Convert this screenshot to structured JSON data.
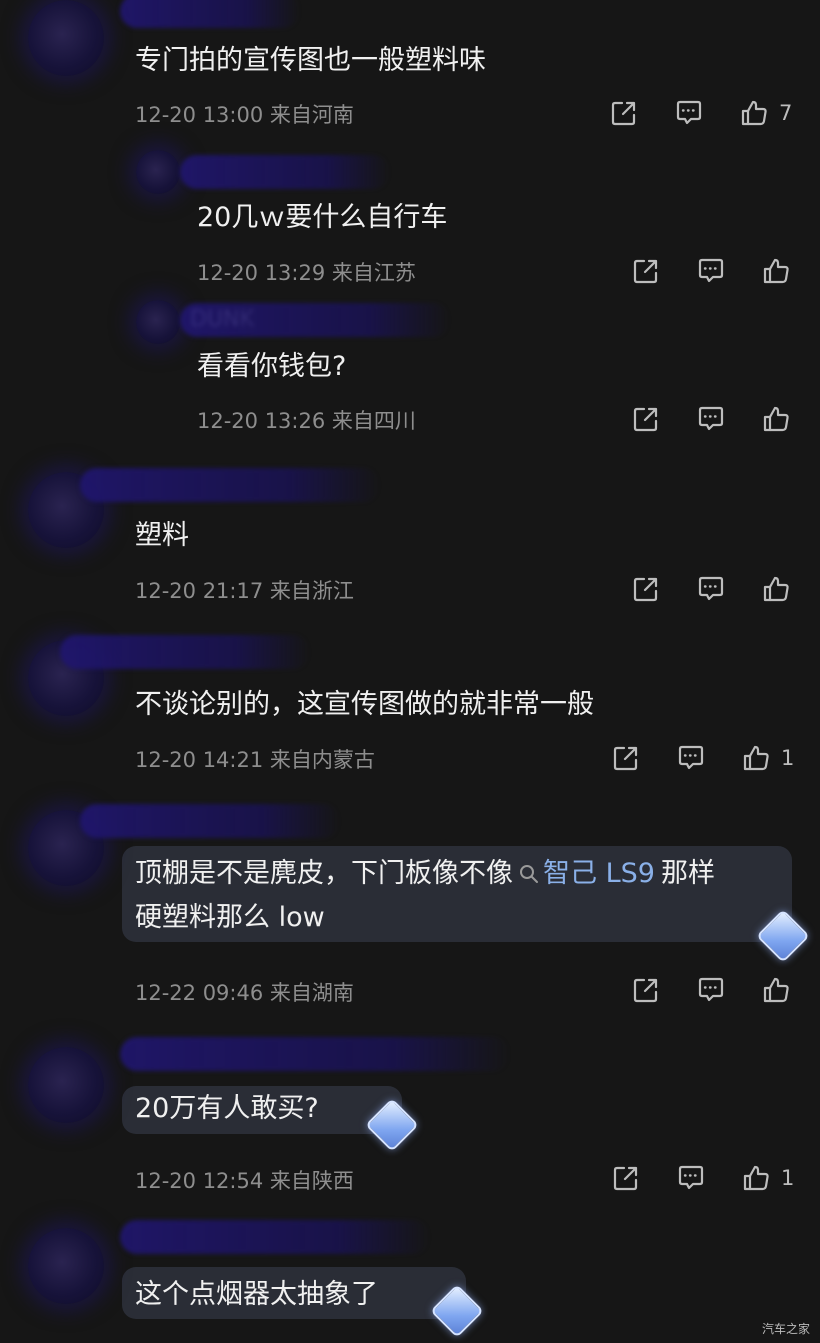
{
  "comments": [
    {
      "username": "",
      "text": "专门拍的宣传图也一般塑料味",
      "time": "12-20 13:00",
      "location": "来自河南",
      "likes": "7"
    },
    {
      "username": "",
      "text": "20几ｗ要什么自行车",
      "time": "12-20 13:29",
      "location": "来自江苏",
      "likes": ""
    },
    {
      "username": "DUNK",
      "text": "看看你钱包?",
      "time": "12-20 13:26",
      "location": "来自四川",
      "likes": ""
    },
    {
      "username": "",
      "text": "塑料",
      "time": "12-20 21:17",
      "location": "来自浙江",
      "likes": ""
    },
    {
      "username": "",
      "text": "不谈论别的，这宣传图做的就非常一般",
      "time": "12-20 14:21",
      "location": "来自内蒙古",
      "likes": "1"
    },
    {
      "username": "",
      "text_part1": "顶棚是不是麂皮，下门板像不像",
      "link": "智己 LS9",
      "text_part2": "那样",
      "text_line2": "硬塑料那么 low",
      "time": "12-22 09:46",
      "location": "来自湖南",
      "likes": ""
    },
    {
      "username": "",
      "text": "20万有人敢买?",
      "time": "12-20 12:54",
      "location": "来自陕西",
      "likes": "1"
    },
    {
      "username": "",
      "text": "这个点烟器太抽象了"
    }
  ],
  "icons": {
    "share": "share-icon",
    "reply": "comment-icon",
    "like": "thumbs-up-icon",
    "search": "search-icon",
    "badge": "diamond-badge-icon"
  },
  "colors": {
    "background": "#161616",
    "link": "#8ab0e8",
    "meta": "#8e8e8e"
  },
  "watermark": "汽车之家"
}
